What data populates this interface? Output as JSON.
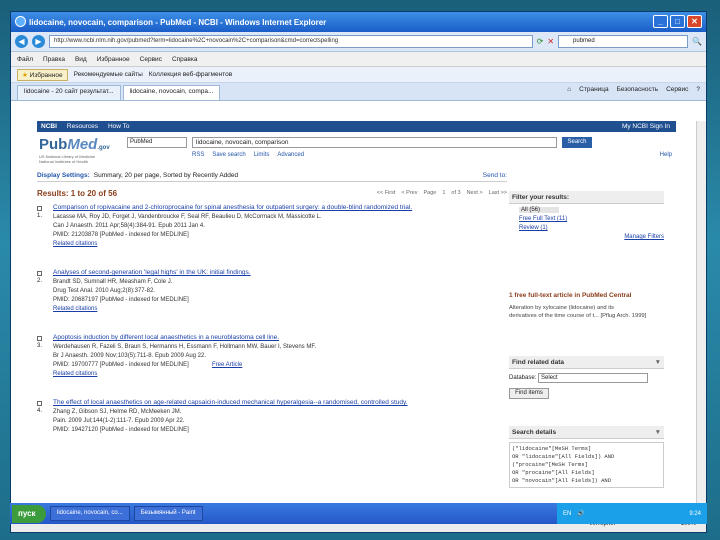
{
  "window": {
    "title": "lidocaine, novocain, comparison - PubMed - NCBI - Windows Internet Explorer"
  },
  "ie": {
    "address": "http://www.ncbi.nlm.nih.gov/pubmed?term=lidocaine%2C+novocain%2C+comparison&cmd=correctspelling",
    "search": "pubmed",
    "menu": [
      "Файл",
      "Правка",
      "Вид",
      "Избранное",
      "Сервис",
      "Справка"
    ],
    "fav_label": "Избранное",
    "fav_links": [
      "Рекомендуемые сайты",
      "Коллекция веб-фрагментов"
    ],
    "tabs": [
      "lidocaine - 20 сайт результат...",
      "lidocaine, novocain, compa..."
    ],
    "tools": [
      "Страница",
      "Безопасность",
      "Сервис"
    ],
    "status": "Интернет",
    "zoom": "100%"
  },
  "ncbi": {
    "brand": "NCBI",
    "resources": "Resources",
    "howto": "How To",
    "signin": "My NCBI Sign In",
    "logo_a": "Pub",
    "logo_b": "Med",
    "logo_c": ".gov",
    "logo_sub": "US National Library of Medicine National Institutes of Health",
    "db": "PubMed",
    "term": "lidocaine, novocain, comparison",
    "search_btn": "Search",
    "links": [
      "RSS",
      "Save search",
      "Limits",
      "Advanced"
    ],
    "help": "Help"
  },
  "results": {
    "display": "Display Settings:",
    "display_val": "Summary, 20 per page, Sorted by Recently Added",
    "send_to": "Send to:",
    "header": "Results: 1 to 20 of 56",
    "pager": [
      "<< First",
      "< Prev",
      "Page",
      "1",
      "of 3",
      "Next >",
      "Last >>"
    ],
    "items": [
      {
        "num": "1.",
        "title": "Comparison of ropivacaine and 2-chloroprocaine for spinal anesthesia for outpatient surgery: a double-blind randomized trial.",
        "authors": "Lacasse MA, Roy JD, Forget J, Vandenbroucke F, Seal RF, Beaulieu D, McCormack M, Massicotte L.",
        "journal": "Can J Anaesth. 2011 Apr;58(4):384-91. Epub 2011 Jan 4.",
        "pmid": "PMID: 21203878 [PubMed - indexed for MEDLINE]",
        "related": "Related citations",
        "extra": ""
      },
      {
        "num": "2.",
        "title": "Analyses of second-generation 'legal highs' in the UK: initial findings.",
        "authors": "Brandt SD, Sumnall HR, Measham F, Cole J.",
        "journal": "Drug Test Anal. 2010 Aug;2(8):377-82.",
        "pmid": "PMID: 20687197 [PubMed - indexed for MEDLINE]",
        "related": "Related citations",
        "extra": ""
      },
      {
        "num": "3.",
        "title": "Apoptosis induction by different local anaesthetics in a neuroblastoma cell line.",
        "authors": "Werdehausen R, Fazeli S, Braun S, Hermanns H, Essmann F, Hollmann MW, Bauer I, Stevens MF.",
        "journal": "Br J Anaesth. 2009 Nov;103(5):711-8. Epub 2009 Aug 22.",
        "pmid": "PMID: 19700777 [PubMed - indexed for MEDLINE]",
        "related": "Related citations",
        "extra": "Free Article"
      },
      {
        "num": "4.",
        "title": "The effect of local anaesthetics on age-related capsaicin-induced mechanical hyperalgesia--a randomised, controlled study.",
        "authors": "Zhang Z, Gibson SJ, Helme RD, McMeeken JM.",
        "journal": "Pain. 2009 Jul;144(1-2):111-7. Epub 2009 Apr 22.",
        "pmid": "PMID: 19427120 [PubMed - indexed for MEDLINE]",
        "related": "Related citations",
        "extra": ""
      }
    ]
  },
  "sidebar": {
    "filter_title": "Filter your results:",
    "filters": [
      "All (56)",
      "Free Full Text (11)",
      "Review (1)"
    ],
    "manage": "Manage Filters",
    "ft_title": "1 free full-text article in PubMed Central",
    "ft_lines": [
      "Alteration by xylocaine (lidocaine) and its",
      "derivatives of the time course of t... [Pflug Arch. 1999]"
    ],
    "related_title": "Find related data",
    "db_label": "Database:",
    "db_val": "Select",
    "find_btn": "Find items",
    "details_title": "Search details",
    "details": "(\"lidocaine\"[MeSH Terms]\nOR \"lidocaine\"[All Fields]) AND\n(\"procaine\"[MeSH Terms]\nOR \"procaine\"[All Fields]\nOR \"novocain\"[All Fields]) AND"
  },
  "taskbar": {
    "start": "пуск",
    "items": [
      "lidocaine, novocain, co...",
      "Безымянный - Paint"
    ],
    "lang": "EN",
    "clock": "9:24"
  }
}
